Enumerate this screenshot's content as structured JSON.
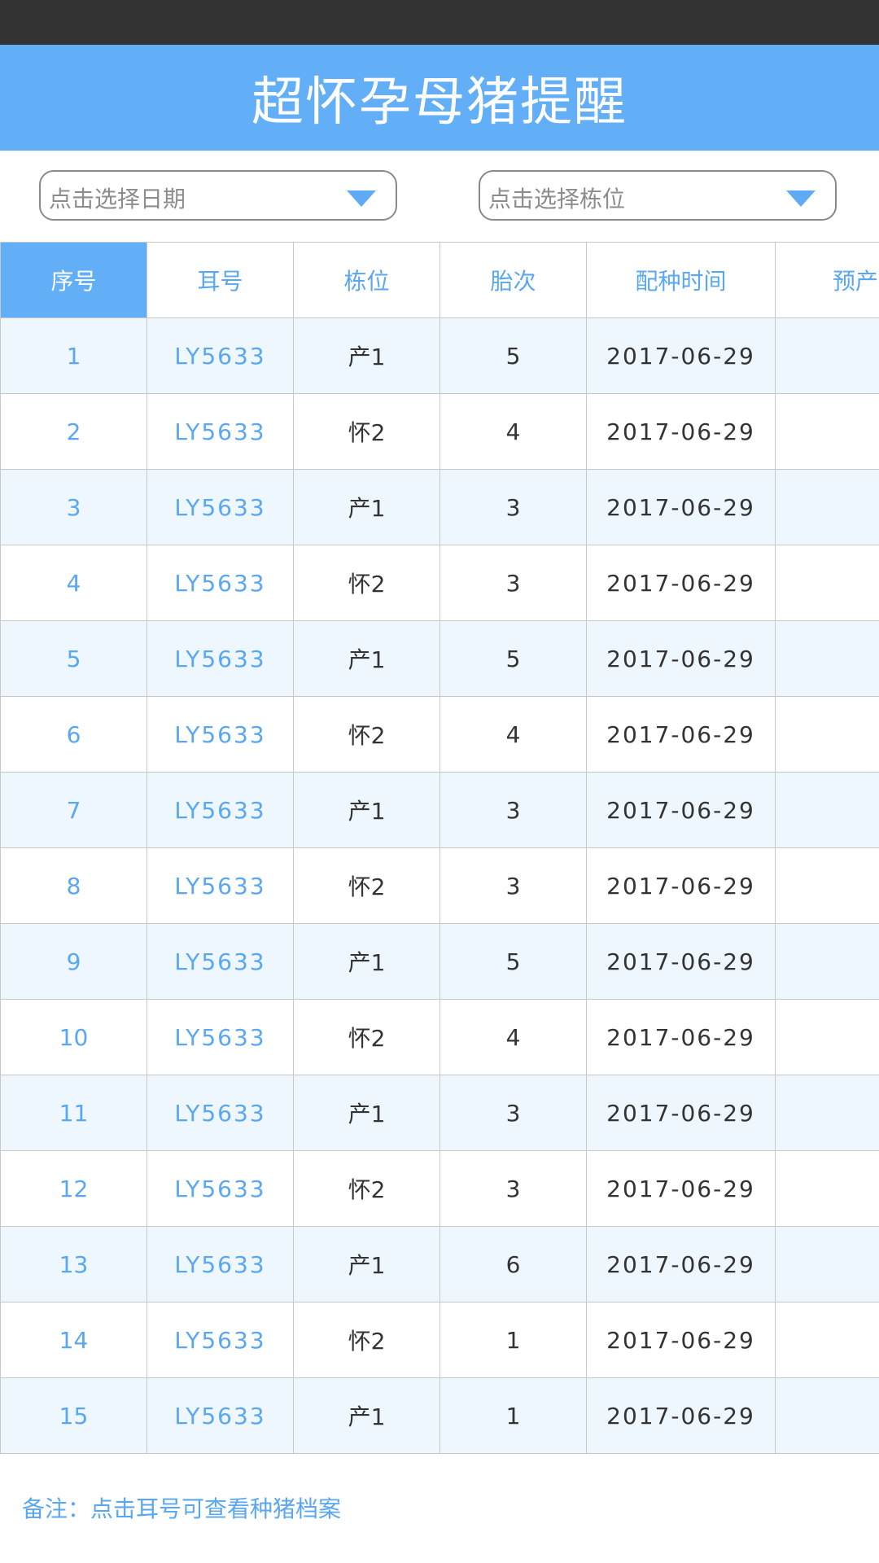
{
  "header": {
    "title": "超怀孕母猪提醒"
  },
  "filters": {
    "date_placeholder": "点击选择日期",
    "pen_placeholder": "点击选择栋位"
  },
  "table": {
    "columns": [
      "序号",
      "耳号",
      "栋位",
      "胎次",
      "配种时间",
      "预产"
    ],
    "rows": [
      {
        "seq": "1",
        "ear": "LY5633",
        "pen": "产1",
        "parity": "5",
        "date": "2017-06-29"
      },
      {
        "seq": "2",
        "ear": "LY5633",
        "pen": "怀2",
        "parity": "4",
        "date": "2017-06-29"
      },
      {
        "seq": "3",
        "ear": "LY5633",
        "pen": "产1",
        "parity": "3",
        "date": "2017-06-29"
      },
      {
        "seq": "4",
        "ear": "LY5633",
        "pen": "怀2",
        "parity": "3",
        "date": "2017-06-29"
      },
      {
        "seq": "5",
        "ear": "LY5633",
        "pen": "产1",
        "parity": "5",
        "date": "2017-06-29"
      },
      {
        "seq": "6",
        "ear": "LY5633",
        "pen": "怀2",
        "parity": "4",
        "date": "2017-06-29"
      },
      {
        "seq": "7",
        "ear": "LY5633",
        "pen": "产1",
        "parity": "3",
        "date": "2017-06-29"
      },
      {
        "seq": "8",
        "ear": "LY5633",
        "pen": "怀2",
        "parity": "3",
        "date": "2017-06-29"
      },
      {
        "seq": "9",
        "ear": "LY5633",
        "pen": "产1",
        "parity": "5",
        "date": "2017-06-29"
      },
      {
        "seq": "10",
        "ear": "LY5633",
        "pen": "怀2",
        "parity": "4",
        "date": "2017-06-29"
      },
      {
        "seq": "11",
        "ear": "LY5633",
        "pen": "产1",
        "parity": "3",
        "date": "2017-06-29"
      },
      {
        "seq": "12",
        "ear": "LY5633",
        "pen": "怀2",
        "parity": "3",
        "date": "2017-06-29"
      },
      {
        "seq": "13",
        "ear": "LY5633",
        "pen": "产1",
        "parity": "6",
        "date": "2017-06-29"
      },
      {
        "seq": "14",
        "ear": "LY5633",
        "pen": "怀2",
        "parity": "1",
        "date": "2017-06-29"
      },
      {
        "seq": "15",
        "ear": "LY5633",
        "pen": "产1",
        "parity": "1",
        "date": "2017-06-29"
      }
    ]
  },
  "footer": {
    "note": "备注：点击耳号可查看种猪档案"
  },
  "colors": {
    "accent": "#62aef7",
    "status_bar": "#333333",
    "row_alt": "#eef6fe"
  },
  "icons": {
    "dropdown": "chevron-down-icon"
  }
}
